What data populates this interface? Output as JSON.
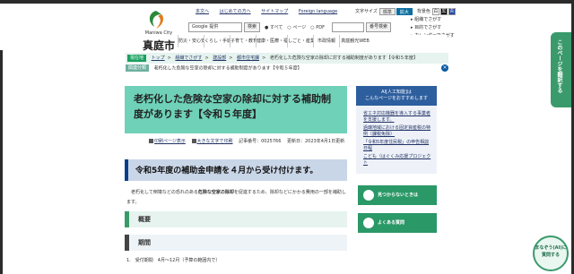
{
  "header": {
    "logo_en": "Maniwa City",
    "logo_jp": "真庭市",
    "top_links": [
      "本文へ",
      "はじめての方へ",
      "サイトマップ",
      "Foreign language"
    ],
    "a11y": {
      "font_size_label": "文字サイズ",
      "standard": "標準",
      "large": "拡大",
      "bg_label": "背景色",
      "colors": [
        "白",
        "黒",
        "青"
      ]
    },
    "search": {
      "placeholder": "Google 提供",
      "button": "検索",
      "radio_all": "すべて",
      "radio_page": "ページ",
      "radio_pdf": "PDF",
      "page_no_button": "番号検索"
    },
    "quick_links": [
      "組織でさがす",
      "目的でさがす",
      "カレンダーでさがす"
    ]
  },
  "gnav": [
    "防災・安心安全",
    "くらし・手続き",
    "子育て・教育",
    "健康・医療・福祉",
    "しごと・産業",
    "市政情報",
    "真庭観光WEB"
  ],
  "breadcrumb": {
    "tag": "現在地",
    "items": [
      "トップ",
      "組織でさがす",
      "建設部",
      "都市住宅課"
    ],
    "current": "老朽化した危険な空家の除却に対する補助制度があります【令和５年度】"
  },
  "related": {
    "tag": "関連分類",
    "text": "老朽化した危険な空家の除却に対する補助制度があります【令和５年度】"
  },
  "page": {
    "title": "老朽化した危険な空家の除却に対する補助制度があります【令和５年度】",
    "print_link": "印刷ページ表示",
    "large_print_link": "大きな文字で印刷",
    "article_no": "記事番号：0025766",
    "updated": "更新日：2023年4月1日更新",
    "subheading": "令和5年度の補助金申請を４月から受け付けます。",
    "body_pre": "　老朽化して倒壊などの恐れのある",
    "body_bold": "危険な空家の除却",
    "body_post": "を促進するため、除却などにかかる費用の一部を補助します。",
    "section_overview": "概要",
    "section_period": "期間",
    "list_item_1": "1.　受付期間　4月～12月（予算の範囲内で）"
  },
  "ai_panel": {
    "header": "AI[人工知能]は\nこんなページをおすすめします",
    "items": [
      "省エネ対応機器を導入する事業者を支援します。",
      "過疎地域における固定資産税の特例（課税免除）",
      "「令和5年度住民税」の申告相談日程",
      "こども（はぐくみ応援プロジェクト"
    ]
  },
  "side_buttons": [
    "見つからないときは",
    "よくある質問"
  ],
  "vertical_tab": "このページを翻訳する",
  "chat": {
    "line1": "まなぞう(AI)に",
    "line2": "質問する"
  },
  "colors": {
    "accent_green": "#3a9a6c",
    "title_bg": "#6fd1b8",
    "nav_blue": "#2d5e9e"
  }
}
